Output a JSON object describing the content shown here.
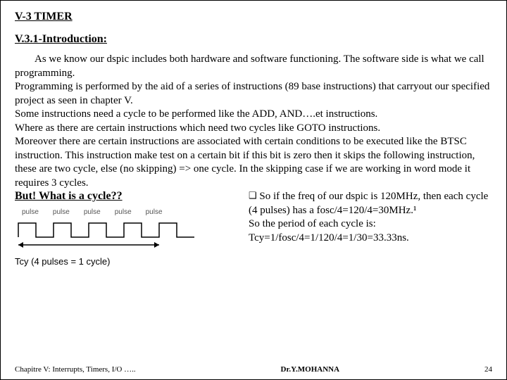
{
  "headings": {
    "main": "V-3 TIMER",
    "sub": "V.3.1-Introduction:"
  },
  "paragraphs": {
    "p1": "As we know our dspic includes both hardware and software functioning. The software side is what we call programming.",
    "p2": "Programming is performed by the aid of a series of instructions (89 base instructions) that carryout our specified project as seen in chapter V.",
    "p3": "Some instructions need a cycle to be performed like the ADD, AND….et instructions.",
    "p4": "Where as there are certain instructions which need two cycles like GOTO instructions.",
    "p5": "Moreover there are certain instructions are associated with certain conditions to be executed like the BTSC instruction. This instruction make test on a certain bit if this bit is zero then it skips the following instruction, these are two cycle, else (no skipping) => one cycle. In the skipping case if we are working in word mode it requires 3 cycles."
  },
  "but_heading": "But! What is a cycle??",
  "pulse_labels": [
    "pulse",
    "pulse",
    "pulse",
    "pulse",
    "pulse"
  ],
  "tcy_line": "Tcy    (4 pulses = 1 cycle)",
  "right_box": {
    "l1": "So if the freq of our dspic is 120MHz, then each cycle (4 pulses) has a fosc/4=120/4=30MHz.¹",
    "l2": "So the period of each cycle is:",
    "l3": "Tcy=1/fosc/4=1/120/4=1/30=33.33ns."
  },
  "footer": {
    "left": "Chapitre V: Interrupts, Timers, I/O …..",
    "center": "Dr.Y.MOHANNA",
    "right": "24"
  }
}
